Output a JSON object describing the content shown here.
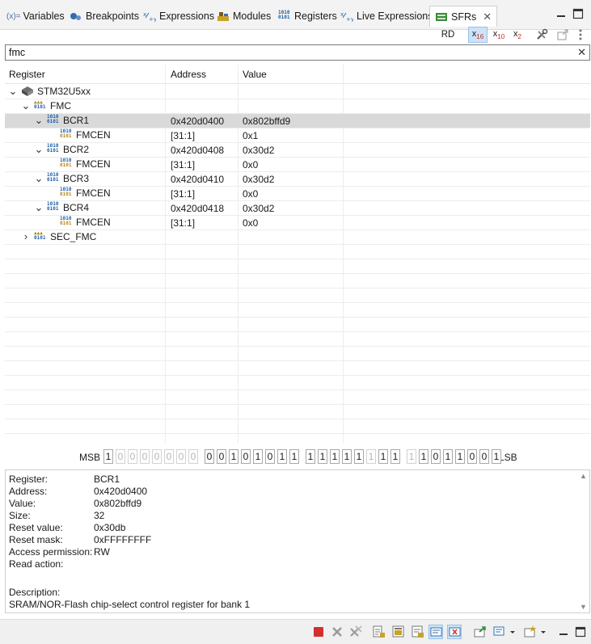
{
  "tabs": [
    {
      "label": "Variables",
      "icon": "variables-icon",
      "glyph": "(x)="
    },
    {
      "label": "Breakpoints",
      "icon": "breakpoints-icon"
    },
    {
      "label": "Expressions",
      "icon": "expressions-icon"
    },
    {
      "label": "Modules",
      "icon": "modules-icon"
    },
    {
      "label": "Registers",
      "icon": "registers-icon"
    },
    {
      "label": "Live Expressions",
      "icon": "live-expressions-icon"
    },
    {
      "label": "SFRs",
      "icon": "sfrs-icon",
      "active": true
    }
  ],
  "toolbar": {
    "rd_label": "RD",
    "hex_label": "x16",
    "dec_label": "x10",
    "bin_label": "x2"
  },
  "filter": {
    "value": "fmc"
  },
  "columns": {
    "register": "Register",
    "address": "Address",
    "value": "Value"
  },
  "tree": [
    {
      "name": "STM32U5xx",
      "address": "",
      "value": "",
      "level": 0,
      "expanded": true,
      "icon": "device-icon"
    },
    {
      "name": "FMC",
      "address": "",
      "value": "",
      "level": 1,
      "expanded": true,
      "icon": "peripheral-icon"
    },
    {
      "name": "BCR1",
      "address": "0x420d0400",
      "value": "0x802bffd9",
      "level": 2,
      "expanded": true,
      "icon": "register-icon",
      "selected": true
    },
    {
      "name": "FMCEN",
      "address": "[31:1]",
      "value": "0x1",
      "level": 3,
      "icon": "field-icon"
    },
    {
      "name": "BCR2",
      "address": "0x420d0408",
      "value": "0x30d2",
      "level": 2,
      "expanded": true,
      "icon": "register-icon"
    },
    {
      "name": "FMCEN",
      "address": "[31:1]",
      "value": "0x0",
      "level": 3,
      "icon": "field-icon"
    },
    {
      "name": "BCR3",
      "address": "0x420d0410",
      "value": "0x30d2",
      "level": 2,
      "expanded": true,
      "icon": "register-icon"
    },
    {
      "name": "FMCEN",
      "address": "[31:1]",
      "value": "0x0",
      "level": 3,
      "icon": "field-icon"
    },
    {
      "name": "BCR4",
      "address": "0x420d0418",
      "value": "0x30d2",
      "level": 2,
      "expanded": true,
      "icon": "register-icon"
    },
    {
      "name": "FMCEN",
      "address": "[31:1]",
      "value": "0x0",
      "level": 3,
      "icon": "field-icon"
    },
    {
      "name": "SEC_FMC",
      "address": "",
      "value": "",
      "level": 1,
      "expanded": false,
      "icon": "peripheral-icon"
    }
  ],
  "bitstrip": {
    "msb_label": "MSB",
    "lsb_label": "LSB",
    "bits": [
      "1",
      "0",
      "0",
      "0",
      "0",
      "0",
      "0",
      "0",
      "0",
      "0",
      "1",
      "0",
      "1",
      "0",
      "1",
      "1",
      "1",
      "1",
      "1",
      "1",
      "1",
      "1",
      "1",
      "1",
      "1",
      "1",
      "0",
      "1",
      "1",
      "0",
      "0",
      "1"
    ],
    "dim": [
      false,
      true,
      true,
      true,
      true,
      true,
      true,
      true,
      false,
      false,
      false,
      false,
      false,
      false,
      false,
      false,
      false,
      false,
      false,
      false,
      false,
      true,
      false,
      false,
      true,
      false,
      false,
      false,
      false,
      false,
      false,
      false
    ]
  },
  "details": {
    "rows": [
      {
        "label": "Register:",
        "value": "BCR1"
      },
      {
        "label": "Address:",
        "value": "0x420d0400"
      },
      {
        "label": "Value:",
        "value": "0x802bffd9"
      },
      {
        "label": "Size:",
        "value": "32"
      },
      {
        "label": "Reset value:",
        "value": "0x30db"
      },
      {
        "label": "Reset mask:",
        "value": "0xFFFFFFFF"
      },
      {
        "label": "Access permission:",
        "value": "RW"
      },
      {
        "label": "Read action:",
        "value": ""
      }
    ],
    "description_label": "Description:",
    "description": "SRAM/NOR-Flash chip-select control register for bank 1"
  },
  "colors": {
    "selection": "#d9d9d9",
    "toggle_on": "#cde3f7",
    "accent_red": "#d32f2f",
    "register_blue": "#1f5fa8"
  }
}
